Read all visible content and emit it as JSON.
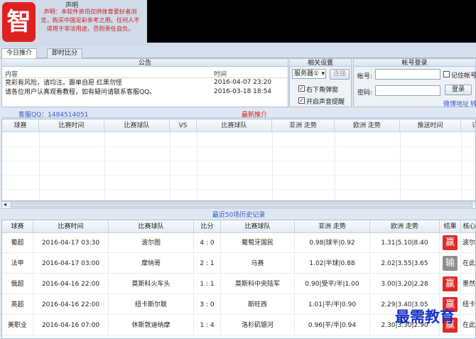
{
  "header": {
    "logo_char": "智",
    "notice_title": "声明",
    "notice_text": "声明：本软件资讯仅供体育爱好者浏览，购买中国足彩参考之用。任何人不得用于非法用途，否则责任自负。"
  },
  "tabs": [
    {
      "label": "今日推介",
      "active": true
    },
    {
      "label": "即时比分",
      "active": false
    }
  ],
  "announce": {
    "title": "公告",
    "col_content": "内容",
    "col_time": "时间",
    "rows": [
      {
        "content": "竞彩有风险，请均注。跟单自愿 红黑勿怪",
        "time": "2016-04-07  23:20"
      },
      {
        "content": "请各位用户认真观看教程，如有疑问请联系客服QQ。",
        "time": "2016-03-18  18:54"
      }
    ]
  },
  "settings": {
    "title": "相关设置",
    "server_value": "服务器①",
    "connect": "连接",
    "opt1": "右下角弹窗",
    "opt2": "开启声音提醒"
  },
  "login": {
    "title": "帐号登录",
    "user_label": "帐号:",
    "pass_label": "密码:",
    "remember": "记住帐号",
    "login_btn": "登录",
    "weibo": "微博地址",
    "link2": "转"
  },
  "midbar": {
    "qq": "客服QQ：1484514051",
    "recommend": "最新推介"
  },
  "grid1": {
    "columns": [
      "球赛",
      "比赛时间",
      "比赛球队",
      "VS",
      "比赛球队",
      "亚洲 走势",
      "欧洲 走势",
      "推送时间",
      "订"
    ]
  },
  "history": {
    "title": "最近50场历史记录",
    "columns": [
      "球赛",
      "比赛时间",
      "比赛球队",
      "比分",
      "比赛球队",
      "亚洲 走势",
      "欧洲 走势",
      "结果",
      "核心"
    ],
    "rows": [
      {
        "league": "葡超",
        "time": "2016-04-17  03:30",
        "home": "波尔图",
        "score": "4 : 0",
        "away": "葡萄牙国民",
        "asia": "0.98|球半|0.92",
        "euro": "1.31|5.10|8.40",
        "result": "赢",
        "core": "波尔"
      },
      {
        "league": "法甲",
        "time": "2016-04-17  03:00",
        "home": "摩纳哥",
        "score": "2 : 1",
        "away": "马赛",
        "asia": "1.02|半球|0.88",
        "euro": "2.02|3.55|3.65",
        "result": "输",
        "core": "在此"
      },
      {
        "league": "俄超",
        "time": "2016-04-16  22:00",
        "home": "莫斯科火车头",
        "score": "1 : 1",
        "away": "莫斯科中央陆军",
        "asia": "0.90|受平/半|1.00",
        "euro": "3.00|3.20|2.28",
        "result": "赢",
        "core": "墨然"
      },
      {
        "league": "英超",
        "time": "2016-04-16  22:00",
        "home": "纽卡斯尔联",
        "score": "3 : 0",
        "away": "斯旺西",
        "asia": "1.01|平/半|0.90",
        "euro": "2.29|3.40|3.05",
        "result": "赢",
        "core": "纽卡"
      },
      {
        "league": "美职业",
        "time": "2016-04-16  07:00",
        "home": "休斯敦迪纳摩",
        "score": "1 : 4",
        "away": "洛杉矶银河",
        "asia": "0.96|平/半|0.94",
        "euro": "2.30|3.30|2.90",
        "result": "赢",
        "core": "在此"
      }
    ]
  },
  "watermark": "最需教育",
  "colors": {
    "win": "#e02a2a",
    "lose": "#8f8f8f",
    "accent": "#d21c1c",
    "link": "#3555d0"
  }
}
